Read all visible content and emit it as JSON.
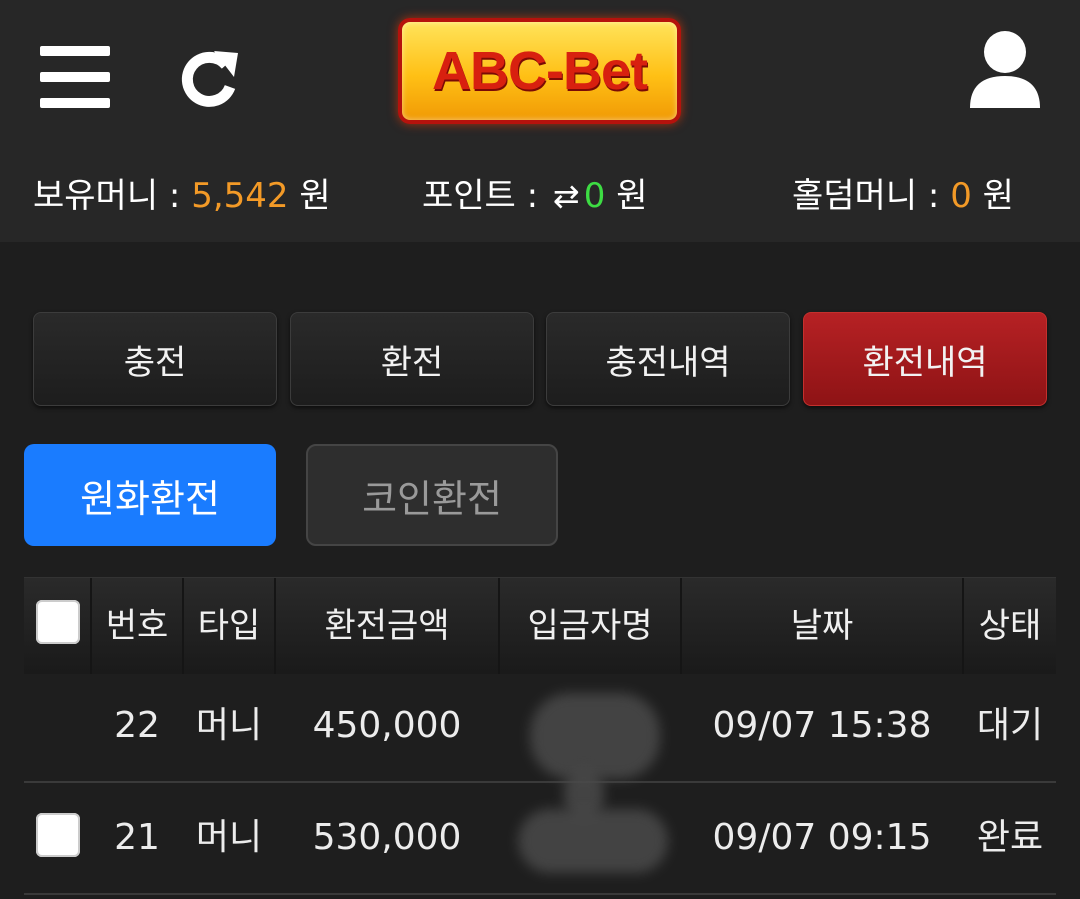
{
  "header": {
    "logo_text": "ABC-Bet",
    "icons": {
      "menu": "hamburger-menu-icon",
      "refresh": "refresh-icon",
      "user": "user-icon"
    }
  },
  "balances": {
    "money_label": "보유머니 : ",
    "money_value": "5,542",
    "point_label": "포인트 : ",
    "point_value": "0",
    "holdem_label": "홀덤머니 : ",
    "holdem_value": "0",
    "currency": "원"
  },
  "tabs": [
    {
      "label": "충전",
      "active": false
    },
    {
      "label": "환전",
      "active": false
    },
    {
      "label": "충전내역",
      "active": false
    },
    {
      "label": "환전내역",
      "active": true
    }
  ],
  "sub_tabs": [
    {
      "label": "원화환전",
      "active": true
    },
    {
      "label": "코인환전",
      "active": false
    }
  ],
  "table": {
    "columns": [
      "번호",
      "타입",
      "환전금액",
      "입금자명",
      "날짜",
      "상태"
    ],
    "rows": [
      {
        "no": "22",
        "type": "머니",
        "amount": "450,000",
        "depositor": "",
        "date": "09/07 15:38",
        "status": "대기",
        "has_checkbox": false
      },
      {
        "no": "21",
        "type": "머니",
        "amount": "530,000",
        "depositor": "",
        "date": "09/07 09:15",
        "status": "완료",
        "has_checkbox": true
      }
    ]
  },
  "colors": {
    "accent_red": "#b62124",
    "accent_blue": "#1a7cff",
    "money_orange": "#f39a27",
    "point_green": "#3ddc43"
  }
}
